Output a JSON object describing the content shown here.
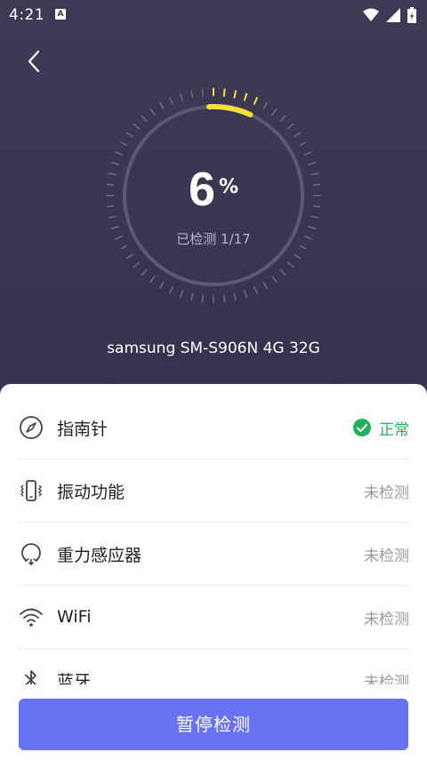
{
  "status_bar": {
    "time": "4:21",
    "notification_badge": "A"
  },
  "gauge": {
    "progress_percent": 6,
    "percent_value": "6",
    "percent_sign": "%",
    "checked_text": "已检测 1/17",
    "accent_color": "#f5e03a"
  },
  "device": {
    "name": "samsung SM-S906N 4G 32G"
  },
  "items": [
    {
      "label": "指南针",
      "status": "正常",
      "state": "ok",
      "icon": "compass-icon"
    },
    {
      "label": "振动功能",
      "status": "未检测",
      "state": "pending",
      "icon": "vibration-icon"
    },
    {
      "label": "重力感应器",
      "status": "未检测",
      "state": "pending",
      "icon": "gravity-sensor-icon"
    },
    {
      "label": "WiFi",
      "status": "未检测",
      "state": "pending",
      "icon": "wifi-icon"
    },
    {
      "label": "蓝牙",
      "status": "未检测",
      "state": "pending",
      "icon": "bluetooth-icon"
    }
  ],
  "action": {
    "pause_label": "暂停检测"
  },
  "colors": {
    "header_bg": "#3e3a56",
    "ok_green": "#23b05d",
    "button_blue": "#6872f2"
  }
}
